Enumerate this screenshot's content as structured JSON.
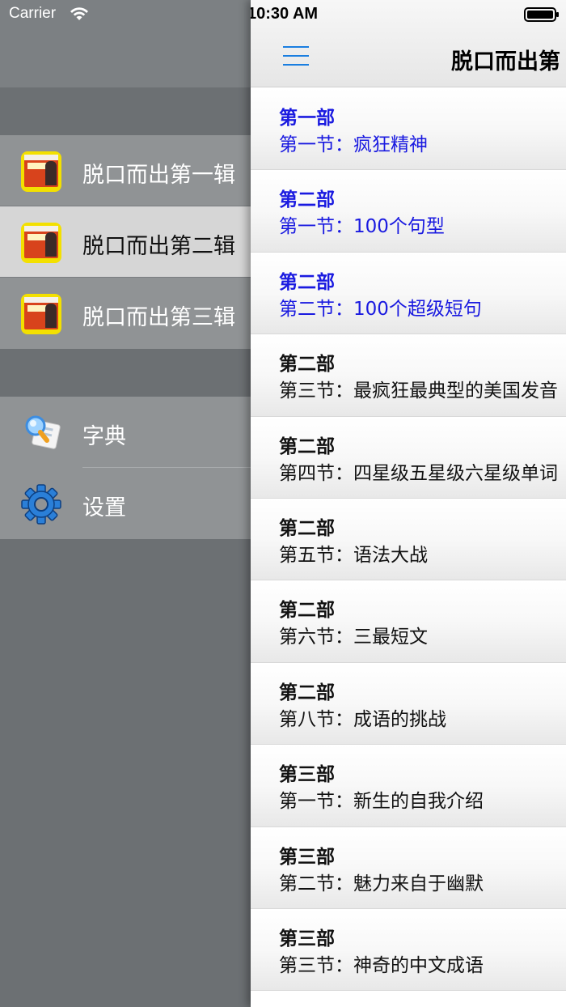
{
  "status_bar": {
    "carrier": "Carrier",
    "time": "10:30 AM"
  },
  "drawer": {
    "collections": [
      {
        "label": "脱口而出第一辑",
        "active": false
      },
      {
        "label": "脱口而出第二辑",
        "active": true
      },
      {
        "label": "脱口而出第三辑",
        "active": false
      }
    ],
    "tools": [
      {
        "label": "字典",
        "icon": "dictionary-icon"
      },
      {
        "label": "设置",
        "icon": "gear-icon"
      }
    ]
  },
  "navbar": {
    "title": "脱口而出第",
    "menu_icon": "hamburger-menu-icon"
  },
  "lessons": [
    {
      "part": "第一部",
      "section": "第一节：疯狂精神",
      "visited": true
    },
    {
      "part": "第二部",
      "section": "第一节：100个句型",
      "visited": true
    },
    {
      "part": "第二部",
      "section": "第二节：100个超级短句",
      "visited": true
    },
    {
      "part": "第二部",
      "section": "第三节：最疯狂最典型的美国发音",
      "visited": false
    },
    {
      "part": "第二部",
      "section": "第四节：四星级五星级六星级单词",
      "visited": false
    },
    {
      "part": "第二部",
      "section": "第五节：语法大战",
      "visited": false
    },
    {
      "part": "第二部",
      "section": "第六节：三最短文",
      "visited": false
    },
    {
      "part": "第二部",
      "section": "第八节：成语的挑战",
      "visited": false
    },
    {
      "part": "第三部",
      "section": "第一节：新生的自我介绍",
      "visited": false
    },
    {
      "part": "第三部",
      "section": "第二节：魅力来自于幽默",
      "visited": false
    },
    {
      "part": "第三部",
      "section": "第三节：神奇的中文成语",
      "visited": false
    }
  ],
  "colors": {
    "visited_text": "#1a1ae0",
    "accent": "#1a7ee0",
    "drawer_bg": "#6c7073"
  }
}
